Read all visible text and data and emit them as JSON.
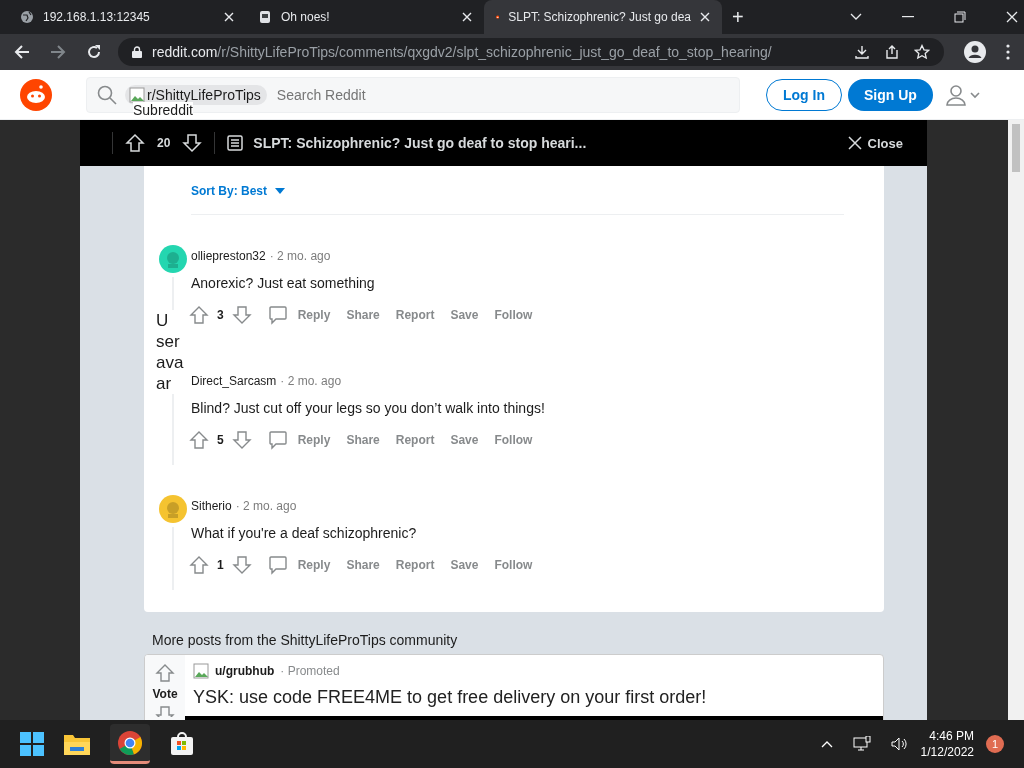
{
  "browser": {
    "tabs": [
      {
        "title": "192.168.1.13:12345",
        "selected": false
      },
      {
        "title": "Oh noes!",
        "selected": false
      },
      {
        "title": "SLPT: Schizophrenic? Just go dea",
        "selected": true
      }
    ],
    "new_tab": "+",
    "url_host": "reddit.com",
    "url_path": "/r/ShittyLifeProTips/comments/qxgdv2/slpt_schizophrenic_just_go_deaf_to_stop_hearing/"
  },
  "header": {
    "community_chip": "r/ShittyLifeProTips",
    "chip_alt": "Subreddit",
    "search_placeholder": "Search Reddit",
    "login": "Log In",
    "signup": "Sign Up"
  },
  "post_bar": {
    "score": "20",
    "title": "SLPT: Schizophrenic? Just go deaf to stop heari...",
    "close": "Close"
  },
  "sort": {
    "label": "Sort By: Best"
  },
  "comments": [
    {
      "author": "olliepreston32",
      "time": "· 2 mo. ago",
      "body": "Anorexic? Just eat something",
      "score": "3",
      "kind": "image",
      "color": "#24d6b0",
      "actions": [
        "Reply",
        "Share",
        "Report",
        "Save",
        "Follow"
      ]
    },
    {
      "author": "Direct_Sarcasm",
      "time": "· 2 mo. ago",
      "body": "Blind? Just cut off your legs so you don’t walk into things!",
      "score": "5",
      "kind": "broken",
      "alt": "U ser ava ar",
      "actions": [
        "Reply",
        "Share",
        "Report",
        "Save",
        "Follow"
      ]
    },
    {
      "author": "Sitherio",
      "time": "· 2 mo. ago",
      "body": "What if you're a deaf schizophrenic?",
      "score": "1",
      "kind": "image",
      "color": "#f5c330",
      "actions": [
        "Reply",
        "Share",
        "Report",
        "Save",
        "Follow"
      ]
    }
  ],
  "more_posts": {
    "heading": "More posts from the ShittyLifeProTips community",
    "vote": "Vote",
    "author": "u/grubhub",
    "promoted": "· Promoted",
    "title": "YSK: use code FREE4ME to get free delivery on your first order!"
  },
  "taskbar": {
    "time": "4:46 PM",
    "date": "1/12/2022",
    "notifications": "1"
  }
}
